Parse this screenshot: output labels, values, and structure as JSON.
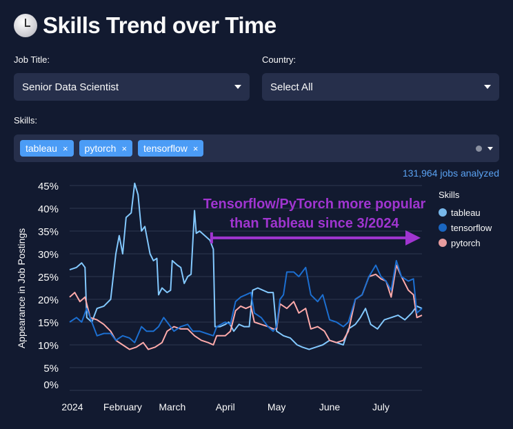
{
  "header": {
    "icon": "clock-icon",
    "title": "Skills Trend over Time"
  },
  "filters": {
    "job_title": {
      "label": "Job Title:",
      "value": "Senior Data Scientist"
    },
    "country": {
      "label": "Country:",
      "value": "Select All"
    },
    "skills": {
      "label": "Skills:",
      "tags": [
        "tableau",
        "pytorch",
        "tensorflow"
      ],
      "remove_glyph": "×"
    }
  },
  "jobs_analyzed": "131,964 jobs analyzed",
  "colors": {
    "tableau": "#83c9ff",
    "tensorflow": "#1c6fd1",
    "pytorch": "#ffabab",
    "annotation": "#a035d0",
    "accent": "#4b9cf6"
  },
  "chart_data": {
    "type": "line",
    "ylabel": "Appearance in Job Postings",
    "xlabel": "",
    "ylim": [
      0,
      45
    ],
    "yticks": [
      "0%",
      "5%",
      "10%",
      "15%",
      "20%",
      "25%",
      "30%",
      "35%",
      "40%",
      "45%"
    ],
    "ytick_values": [
      0,
      5,
      10,
      15,
      20,
      25,
      30,
      35,
      40,
      45
    ],
    "xticks": [
      {
        "date": "2024-01-01",
        "label": "2024"
      },
      {
        "date": "2024-02-01",
        "label": "February"
      },
      {
        "date": "2024-03-01",
        "label": "March"
      },
      {
        "date": "2024-04-01",
        "label": "April"
      },
      {
        "date": "2024-05-01",
        "label": "May"
      },
      {
        "date": "2024-06-01",
        "label": "June"
      },
      {
        "date": "2024-07-01",
        "label": "July"
      }
    ],
    "xrange": [
      "2024-01-01",
      "2024-07-25"
    ],
    "grid": "horizontal",
    "legend": {
      "title": "Skills",
      "placement": "right",
      "entries": [
        "tableau",
        "tensorflow",
        "pytorch"
      ]
    },
    "annotation": {
      "text_line1": "Tensorflow/PyTorch more popular",
      "text_line2": "than Tableau since 3/2024",
      "arrow_from": "2024-03-24",
      "arrow_to": "2024-07-25",
      "arrow_y": 33.5
    },
    "series": [
      {
        "name": "tableau",
        "points": [
          [
            "2024-01-01",
            26.5
          ],
          [
            "2024-01-05",
            27
          ],
          [
            "2024-01-08",
            28
          ],
          [
            "2024-01-10",
            27
          ],
          [
            "2024-01-11",
            16
          ],
          [
            "2024-01-14",
            15
          ],
          [
            "2024-01-17",
            18
          ],
          [
            "2024-01-21",
            18.5
          ],
          [
            "2024-01-25",
            20
          ],
          [
            "2024-01-28",
            30
          ],
          [
            "2024-01-30",
            34
          ],
          [
            "2024-02-01",
            30
          ],
          [
            "2024-02-03",
            38
          ],
          [
            "2024-02-06",
            39
          ],
          [
            "2024-02-08",
            45.5
          ],
          [
            "2024-02-10",
            43
          ],
          [
            "2024-02-12",
            35
          ],
          [
            "2024-02-14",
            36
          ],
          [
            "2024-02-17",
            30
          ],
          [
            "2024-02-19",
            28.5
          ],
          [
            "2024-02-21",
            29
          ],
          [
            "2024-02-22",
            21
          ],
          [
            "2024-02-24",
            22.5
          ],
          [
            "2024-02-27",
            21.5
          ],
          [
            "2024-02-29",
            22
          ],
          [
            "2024-03-01",
            28.5
          ],
          [
            "2024-03-04",
            27.5
          ],
          [
            "2024-03-06",
            27
          ],
          [
            "2024-03-08",
            23.5
          ],
          [
            "2024-03-10",
            25
          ],
          [
            "2024-03-12",
            25.5
          ],
          [
            "2024-03-14",
            39.5
          ],
          [
            "2024-03-15",
            34.5
          ],
          [
            "2024-03-17",
            35
          ],
          [
            "2024-03-20",
            34
          ],
          [
            "2024-03-23",
            33
          ],
          [
            "2024-03-25",
            31
          ],
          [
            "2024-03-26",
            14
          ],
          [
            "2024-03-29",
            14
          ],
          [
            "2024-04-01",
            14.5
          ],
          [
            "2024-04-03",
            15
          ],
          [
            "2024-04-06",
            13
          ],
          [
            "2024-04-09",
            14.5
          ],
          [
            "2024-04-12",
            14
          ],
          [
            "2024-04-15",
            14
          ],
          [
            "2024-04-17",
            22
          ],
          [
            "2024-04-20",
            22.5
          ],
          [
            "2024-04-23",
            22
          ],
          [
            "2024-04-26",
            21.5
          ],
          [
            "2024-04-29",
            21.5
          ],
          [
            "2024-05-01",
            13
          ],
          [
            "2024-05-05",
            12
          ],
          [
            "2024-05-09",
            11.5
          ],
          [
            "2024-05-13",
            10
          ],
          [
            "2024-05-16",
            9.5
          ],
          [
            "2024-05-20",
            9
          ],
          [
            "2024-05-24",
            9.5
          ],
          [
            "2024-05-28",
            10
          ],
          [
            "2024-06-01",
            11
          ],
          [
            "2024-06-05",
            10.5
          ],
          [
            "2024-06-09",
            10
          ],
          [
            "2024-06-12",
            13.5
          ],
          [
            "2024-06-16",
            14.5
          ],
          [
            "2024-06-19",
            16
          ],
          [
            "2024-06-22",
            18
          ],
          [
            "2024-06-25",
            14.5
          ],
          [
            "2024-06-29",
            13.5
          ],
          [
            "2024-07-03",
            15.5
          ],
          [
            "2024-07-07",
            16
          ],
          [
            "2024-07-11",
            16.5
          ],
          [
            "2024-07-15",
            15.5
          ],
          [
            "2024-07-19",
            17
          ],
          [
            "2024-07-22",
            18.5
          ],
          [
            "2024-07-25",
            18
          ]
        ]
      },
      {
        "name": "tensorflow",
        "points": [
          [
            "2024-01-01",
            15
          ],
          [
            "2024-01-05",
            16
          ],
          [
            "2024-01-08",
            15
          ],
          [
            "2024-01-11",
            18
          ],
          [
            "2024-01-14",
            15
          ],
          [
            "2024-01-17",
            12
          ],
          [
            "2024-01-21",
            12.5
          ],
          [
            "2024-01-25",
            12.5
          ],
          [
            "2024-01-28",
            11
          ],
          [
            "2024-02-01",
            12
          ],
          [
            "2024-02-05",
            11.5
          ],
          [
            "2024-02-08",
            10.5
          ],
          [
            "2024-02-12",
            14
          ],
          [
            "2024-02-15",
            13
          ],
          [
            "2024-02-19",
            13
          ],
          [
            "2024-02-22",
            14
          ],
          [
            "2024-02-25",
            16
          ],
          [
            "2024-02-28",
            14.5
          ],
          [
            "2024-03-02",
            13
          ],
          [
            "2024-03-06",
            14
          ],
          [
            "2024-03-10",
            14.5
          ],
          [
            "2024-03-13",
            13
          ],
          [
            "2024-03-17",
            13
          ],
          [
            "2024-03-21",
            12.5
          ],
          [
            "2024-03-25",
            12
          ],
          [
            "2024-03-27",
            14
          ],
          [
            "2024-04-01",
            15
          ],
          [
            "2024-04-04",
            14.5
          ],
          [
            "2024-04-07",
            19.5
          ],
          [
            "2024-04-10",
            20.5
          ],
          [
            "2024-04-13",
            21
          ],
          [
            "2024-04-16",
            21.5
          ],
          [
            "2024-04-18",
            17
          ],
          [
            "2024-04-22",
            16
          ],
          [
            "2024-04-26",
            14
          ],
          [
            "2024-04-29",
            13
          ],
          [
            "2024-05-01",
            14
          ],
          [
            "2024-05-03",
            20
          ],
          [
            "2024-05-05",
            21
          ],
          [
            "2024-05-07",
            26
          ],
          [
            "2024-05-11",
            26
          ],
          [
            "2024-05-14",
            25
          ],
          [
            "2024-05-18",
            27
          ],
          [
            "2024-05-21",
            21
          ],
          [
            "2024-05-25",
            19.5
          ],
          [
            "2024-05-28",
            21
          ],
          [
            "2024-06-01",
            15.5
          ],
          [
            "2024-06-05",
            15
          ],
          [
            "2024-06-09",
            14
          ],
          [
            "2024-06-12",
            15
          ],
          [
            "2024-06-16",
            20
          ],
          [
            "2024-06-20",
            21
          ],
          [
            "2024-06-24",
            25
          ],
          [
            "2024-06-28",
            27.5
          ],
          [
            "2024-07-01",
            25
          ],
          [
            "2024-07-04",
            24
          ],
          [
            "2024-07-07",
            22
          ],
          [
            "2024-07-10",
            28.5
          ],
          [
            "2024-07-13",
            25
          ],
          [
            "2024-07-17",
            24
          ],
          [
            "2024-07-20",
            24.5
          ],
          [
            "2024-07-22",
            17
          ],
          [
            "2024-07-25",
            18
          ]
        ]
      },
      {
        "name": "pytorch",
        "points": [
          [
            "2024-01-01",
            20.5
          ],
          [
            "2024-01-04",
            21.5
          ],
          [
            "2024-01-07",
            19.5
          ],
          [
            "2024-01-10",
            20.5
          ],
          [
            "2024-01-13",
            16
          ],
          [
            "2024-01-17",
            15.5
          ],
          [
            "2024-01-21",
            14.5
          ],
          [
            "2024-01-25",
            13
          ],
          [
            "2024-01-28",
            11
          ],
          [
            "2024-02-01",
            10
          ],
          [
            "2024-02-05",
            9
          ],
          [
            "2024-02-09",
            9.5
          ],
          [
            "2024-02-13",
            10.5
          ],
          [
            "2024-02-16",
            9
          ],
          [
            "2024-02-20",
            9.5
          ],
          [
            "2024-02-24",
            10.5
          ],
          [
            "2024-02-27",
            13
          ],
          [
            "2024-03-02",
            14
          ],
          [
            "2024-03-06",
            13.5
          ],
          [
            "2024-03-10",
            13.5
          ],
          [
            "2024-03-14",
            12
          ],
          [
            "2024-03-18",
            11
          ],
          [
            "2024-03-22",
            10.5
          ],
          [
            "2024-03-25",
            10
          ],
          [
            "2024-03-27",
            12
          ],
          [
            "2024-04-01",
            12
          ],
          [
            "2024-04-04",
            13
          ],
          [
            "2024-04-07",
            17.5
          ],
          [
            "2024-04-10",
            18.5
          ],
          [
            "2024-04-13",
            18
          ],
          [
            "2024-04-16",
            18.5
          ],
          [
            "2024-04-18",
            15
          ],
          [
            "2024-04-22",
            14.5
          ],
          [
            "2024-04-26",
            14
          ],
          [
            "2024-04-29",
            13.5
          ],
          [
            "2024-05-01",
            13.5
          ],
          [
            "2024-05-03",
            19
          ],
          [
            "2024-05-07",
            18
          ],
          [
            "2024-05-11",
            19.5
          ],
          [
            "2024-05-14",
            17
          ],
          [
            "2024-05-18",
            18
          ],
          [
            "2024-05-21",
            13.5
          ],
          [
            "2024-05-25",
            14
          ],
          [
            "2024-05-29",
            13
          ],
          [
            "2024-06-01",
            11
          ],
          [
            "2024-06-05",
            10.5
          ],
          [
            "2024-06-09",
            11
          ],
          [
            "2024-06-12",
            13
          ],
          [
            "2024-06-16",
            20
          ],
          [
            "2024-06-20",
            21
          ],
          [
            "2024-06-24",
            25
          ],
          [
            "2024-06-28",
            25.5
          ],
          [
            "2024-07-01",
            24.5
          ],
          [
            "2024-07-04",
            24
          ],
          [
            "2024-07-07",
            20.5
          ],
          [
            "2024-07-10",
            27.5
          ],
          [
            "2024-07-13",
            25
          ],
          [
            "2024-07-17",
            22
          ],
          [
            "2024-07-20",
            21
          ],
          [
            "2024-07-22",
            16
          ],
          [
            "2024-07-25",
            16.5
          ]
        ]
      }
    ]
  }
}
